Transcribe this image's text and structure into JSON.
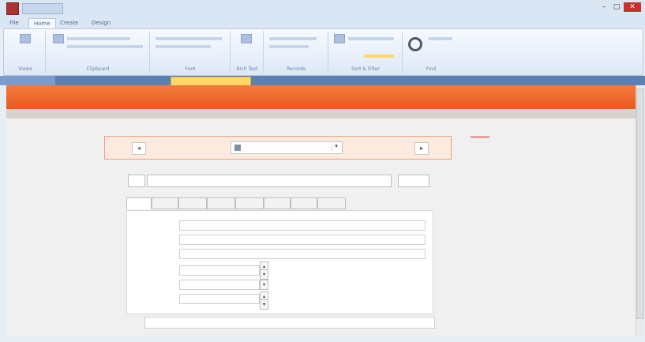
{
  "app": {
    "window_title": "",
    "tabs": [
      {
        "label": "File"
      },
      {
        "label": "Home"
      },
      {
        "label": "Create"
      },
      {
        "label": "Design"
      }
    ],
    "ribbon_groups": [
      {
        "label": "Views"
      },
      {
        "label": "Clipboard"
      },
      {
        "label": "Font"
      },
      {
        "label": "Rich Text"
      },
      {
        "label": "Records"
      },
      {
        "label": "Sort & Filter"
      },
      {
        "label": "Find"
      }
    ],
    "document_tab": ""
  },
  "form": {
    "header_title": "",
    "nav": {
      "prev_label": "◂",
      "next_label": "▸",
      "combo_value": ""
    },
    "add_button": "",
    "title_field_value": "",
    "close_button": "",
    "tabs": [
      {
        "label": ""
      },
      {
        "label": ""
      },
      {
        "label": ""
      },
      {
        "label": ""
      },
      {
        "label": ""
      },
      {
        "label": ""
      },
      {
        "label": ""
      },
      {
        "label": ""
      }
    ],
    "fields": [
      {
        "label": ""
      },
      {
        "label": ""
      },
      {
        "label": ""
      },
      {
        "label": ""
      },
      {
        "label": ""
      },
      {
        "label": ""
      }
    ],
    "bottom_label": ""
  },
  "colors": {
    "header_orange": "#ec6428",
    "accent_red": "#d0433b",
    "nav_blue": "#5d80b3"
  }
}
